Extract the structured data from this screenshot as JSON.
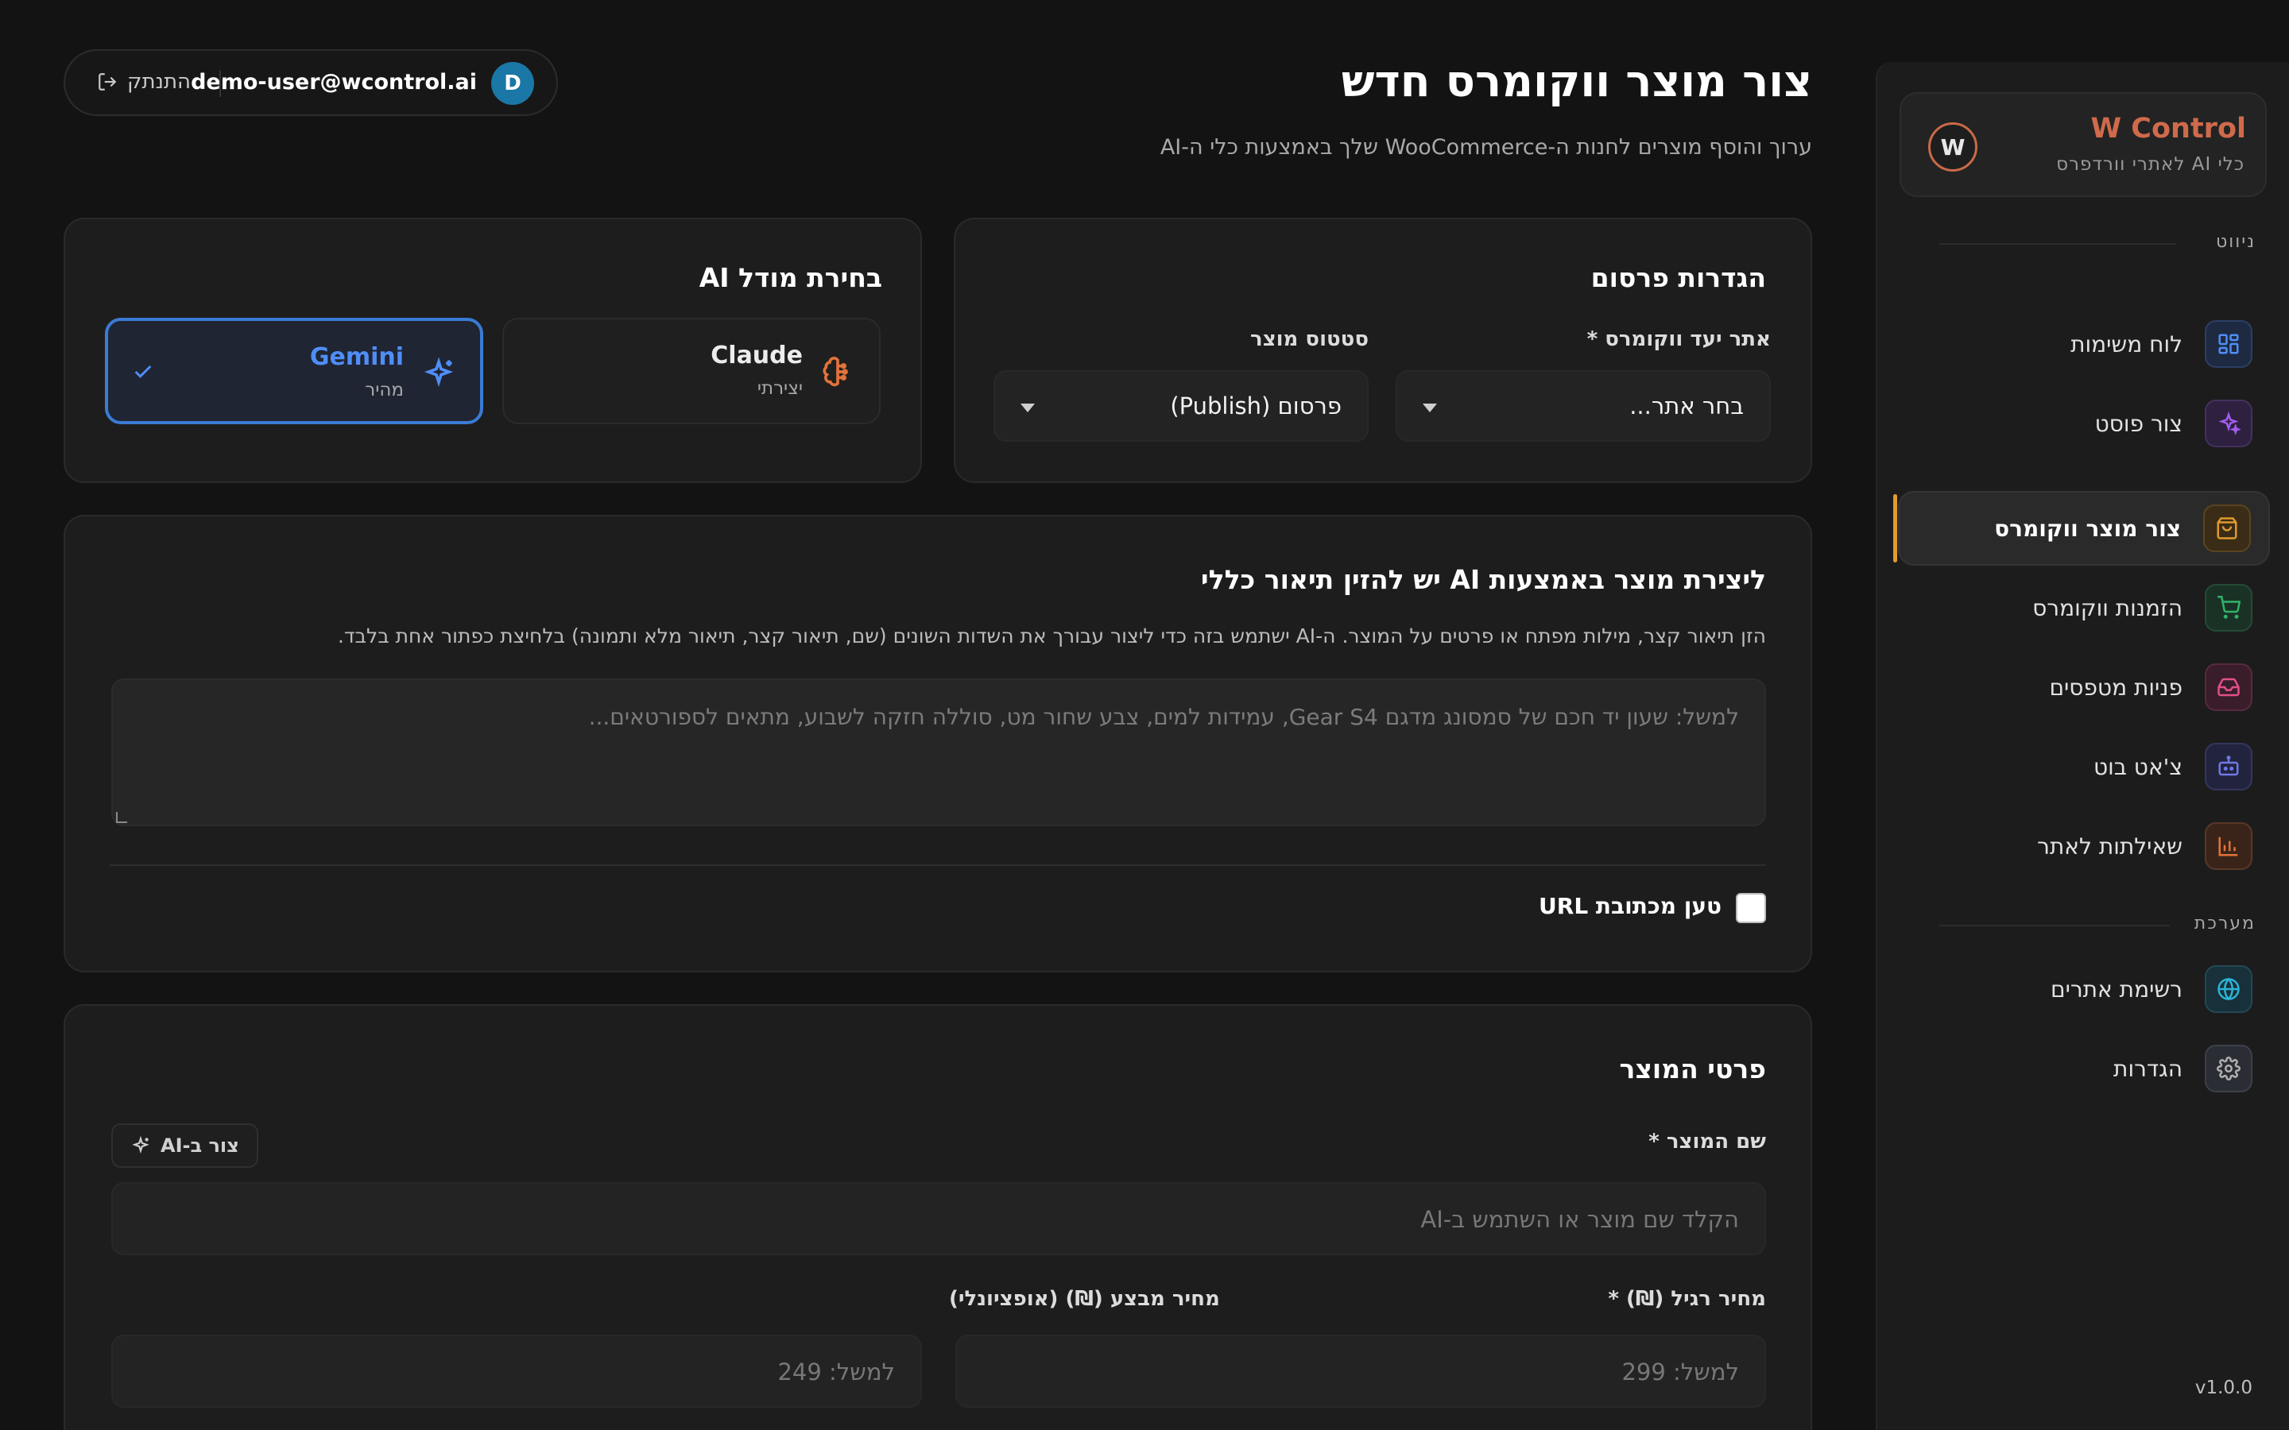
{
  "sidebar": {
    "brand_title": "W Control",
    "brand_sub": "כלי AI לאתרי וורדפרס",
    "logo_letter": "W",
    "section_nav": "ניווט",
    "section_system": "מערכת",
    "items": [
      {
        "label": "לוח משימות",
        "icon": "dashboard-icon",
        "color": "#4f8ef7"
      },
      {
        "label": "צור פוסט",
        "icon": "sparkles-icon",
        "color": "#a35cf0"
      },
      {
        "label": "צור מוצר ווקומרס",
        "icon": "shopping-bag-icon",
        "color": "#e09a2e"
      },
      {
        "label": "הזמנות ווקומרס",
        "icon": "cart-icon",
        "color": "#2fb36a"
      },
      {
        "label": "פניות מטפסים",
        "icon": "inbox-icon",
        "color": "#e24f8b"
      },
      {
        "label": "צ'אט בוט",
        "icon": "bot-icon",
        "color": "#6e78e6"
      },
      {
        "label": "שאילתות לאתר",
        "icon": "bar-chart-icon",
        "color": "#e2733a"
      }
    ],
    "system_items": [
      {
        "label": "רשימת אתרים",
        "icon": "globe-icon",
        "color": "#2bb3d6"
      },
      {
        "label": "הגדרות",
        "icon": "gear-icon",
        "color": "#a8a8a8"
      }
    ],
    "version": "v1.0.0"
  },
  "header": {
    "title": "צור מוצר ווקומרס חדש",
    "subtitle": "ערוך והוסף מוצרים לחנות ה-WooCommerce שלך באמצעות כלי ה-AI",
    "user_initial": "D",
    "user_email": "demo-user@wcontrol.ai",
    "logout_label": "התנתק"
  },
  "publish": {
    "title": "הגדרות פרסום",
    "site_label": "אתר יעד ווקומרס *",
    "site_value": "בחר אתר...",
    "status_label": "סטטוס מוצר",
    "status_value": "פרסום (Publish)"
  },
  "model": {
    "title": "בחירת מודל AI",
    "claude_name": "Claude",
    "claude_sub": "יצירתי",
    "gemini_name": "Gemini",
    "gemini_sub": "מהיר",
    "selected": "Gemini",
    "accent": "#3a7bd5"
  },
  "ai_desc": {
    "title": "ליצירת מוצר באמצעות AI יש להזין תיאור כללי",
    "help": "הזן תיאור קצר, מילות מפתח או פרטים על המוצר. ה-AI ישתמש בזה כדי ליצור עבורך את השדות השונים (שם, תיאור קצר, תיאור מלא ותמונה) בלחיצת כפתור אחת בלבד.",
    "placeholder": "למשל: שעון יד חכם של סמסונג מדגם Gear S4, עמידות למים, צבע שחור מט, סוללה חזקה לשבוע, מתאים לספורטאים...",
    "url_checkbox_label": "טען מכתובת URL",
    "url_checked": false
  },
  "details": {
    "title": "פרטי המוצר",
    "name_label": "שם המוצר *",
    "ai_button": "צור ב-AI",
    "name_placeholder": "הקלד שם מוצר או השתמש ב-AI",
    "regular_label": "מחיר רגיל (₪) *",
    "regular_placeholder": "למשל: 299",
    "sale_label": "מחיר מבצע (₪) (אופציונלי)",
    "sale_placeholder": "למשל: 249"
  }
}
